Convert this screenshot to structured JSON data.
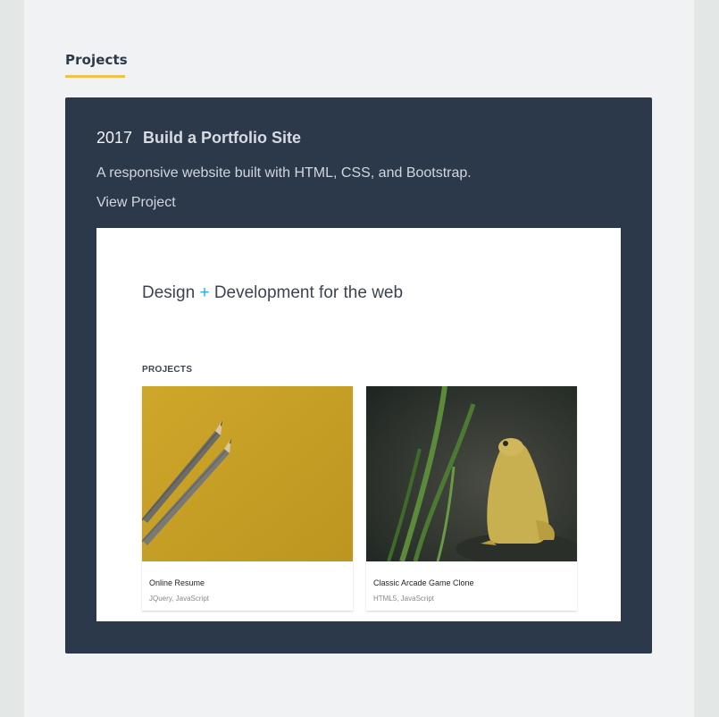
{
  "section": {
    "title": "Projects"
  },
  "project": {
    "year": "2017",
    "title": "Build a Portfolio Site",
    "description": "A responsive website built with HTML, CSS, and Bootstrap.",
    "link_label": "View Project"
  },
  "screenshot": {
    "heading_before": "Design",
    "heading_plus": "+",
    "heading_after": "Development for the web",
    "projects_label": "PROJECTS",
    "tiles": [
      {
        "name": "Online Resume",
        "tags": "JQuery, JavaScript",
        "image": "pencils-on-yellow"
      },
      {
        "name": "Classic Arcade Game Clone",
        "tags": "HTML5, JavaScript",
        "image": "yellow-frog"
      }
    ]
  },
  "colors": {
    "accent": "#f0c04a",
    "card": "#2c394b",
    "plus": "#27a9e1"
  }
}
